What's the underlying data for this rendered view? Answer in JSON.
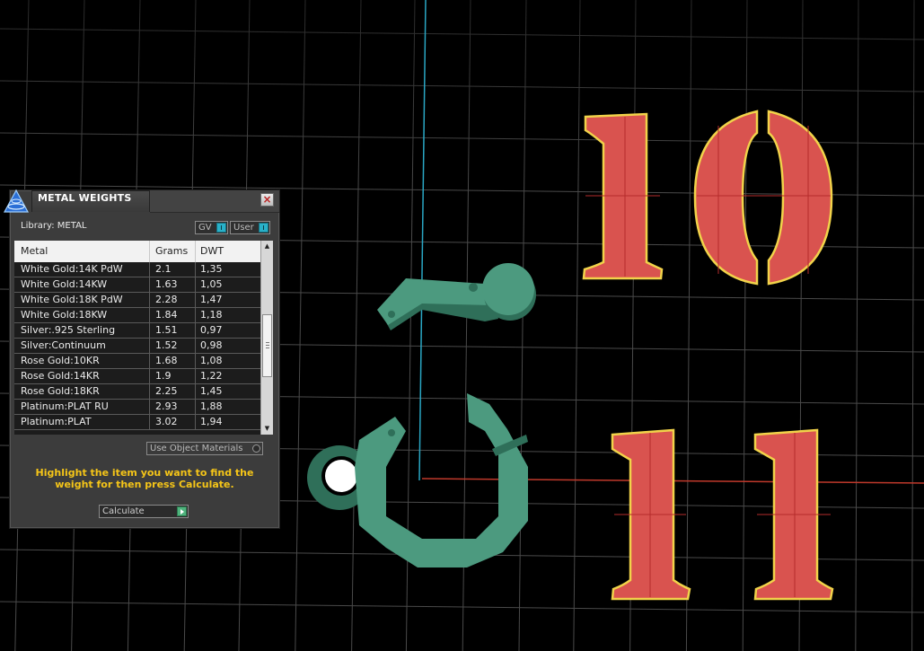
{
  "panel": {
    "title": "METAL WEIGHTS",
    "close_glyph": "×",
    "library_label": "Library: METAL",
    "toggles": {
      "gv_label": "GV",
      "user_label": "User"
    },
    "table": {
      "columns": [
        "Metal",
        "Grams",
        "DWT"
      ],
      "rows": [
        [
          "White Gold:14K PdW",
          "2.1",
          "1,35"
        ],
        [
          "White Gold:14KW",
          "1.63",
          "1,05"
        ],
        [
          "White Gold:18K PdW",
          "2.28",
          "1,47"
        ],
        [
          "White Gold:18KW",
          "1.84",
          "1,18"
        ],
        [
          "Silver:.925 Sterling",
          "1.51",
          "0,97"
        ],
        [
          "Silver:Continuum",
          "1.52",
          "0,98"
        ],
        [
          "Rose Gold:10KR",
          "1.68",
          "1,08"
        ],
        [
          "Rose Gold:14KR",
          "1.9",
          "1,22"
        ],
        [
          "Rose Gold:18KR",
          "2.25",
          "1,45"
        ],
        [
          "Platinum:PLAT RU",
          "2.93",
          "1,88"
        ],
        [
          "Platinum:PLAT",
          "3.02",
          "1,94"
        ]
      ]
    },
    "use_object_materials_label": "Use Object Materials",
    "instructions": "Highlight the item you want to find the weight for then press Calculate.",
    "calculate_label": "Calculate"
  },
  "viewport": {
    "labels": [
      "10",
      "11"
    ],
    "colors": {
      "background": "#000000",
      "grid": "#4a4a4a",
      "axis_y": "#2aa7c4",
      "axis_x": "#c0392b",
      "number_fill": "#d9534f",
      "number_outline": "#f1d34a",
      "part_fill": "#4c9a7f",
      "part_shade": "#2f6f59",
      "accent": "#f5c518"
    }
  }
}
